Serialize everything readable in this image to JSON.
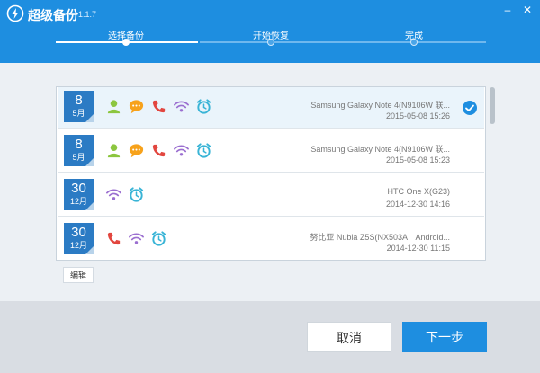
{
  "app": {
    "title": "超级备份",
    "version": "1.1.7"
  },
  "window": {
    "minimize_glyph": "–",
    "close_glyph": "✕"
  },
  "steps": [
    {
      "label": "选择备份",
      "state": "active"
    },
    {
      "label": "开始恢复",
      "state": "pending"
    },
    {
      "label": "完成",
      "state": "pending"
    }
  ],
  "backups": [
    {
      "day": "8",
      "month": "5月",
      "device": "Samsung Galaxy Note 4(N9106W 联...",
      "time": "2015-05-08 15:26",
      "icons": [
        "contacts-icon",
        "sms-icon",
        "call-log-icon",
        "wifi-icon",
        "alarm-icon"
      ],
      "selected": true
    },
    {
      "day": "8",
      "month": "5月",
      "device": "Samsung Galaxy Note 4(N9106W 联...",
      "time": "2015-05-08 15:23",
      "icons": [
        "contacts-icon",
        "sms-icon",
        "call-log-icon",
        "wifi-icon",
        "alarm-icon"
      ],
      "selected": false
    },
    {
      "day": "30",
      "month": "12月",
      "device": "HTC One X(G23)",
      "time": "2014-12-30 14:16",
      "icons": [
        "wifi-icon",
        "alarm-icon"
      ],
      "selected": false
    },
    {
      "day": "30",
      "month": "12月",
      "device": "努比亚 Nubia Z5S(NX503A　Android...",
      "time": "2014-12-30 11:15",
      "icons": [
        "call-log-icon",
        "wifi-icon",
        "alarm-icon"
      ],
      "selected": false
    }
  ],
  "edit_label": "编辑",
  "buttons": {
    "cancel": "取消",
    "next": "下一步"
  },
  "colors": {
    "brand": "#1e8ee0",
    "calendar": "#2b7bc4",
    "contacts": "#8cc63f",
    "sms": "#f7a21b",
    "call": "#e2463f",
    "wifi": "#9b6fd0",
    "alarm": "#39b4d6"
  }
}
